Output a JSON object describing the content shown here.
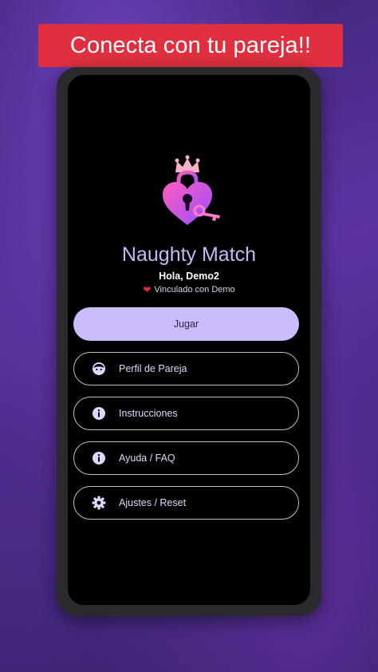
{
  "banner": {
    "text": "Conecta con tu pareja!!"
  },
  "app": {
    "title": "Naughty Match",
    "greeting": "Hola, Demo2",
    "linked_text": "Vinculado con Demo",
    "linked_icon": "heart-icon"
  },
  "buttons": {
    "play": "Jugar",
    "profile": {
      "label": "Perfil de Pareja",
      "icon": "face-icon"
    },
    "instructions": {
      "label": "Instrucciones",
      "icon": "info-icon"
    },
    "help": {
      "label": "Ayuda / FAQ",
      "icon": "info-icon"
    },
    "settings": {
      "label": "Ajustes / Reset",
      "icon": "gear-icon"
    }
  },
  "colors": {
    "banner": "#e0303f",
    "accent": "#cdbcfb",
    "title": "#c9b6f5",
    "logo_pink": "#ff4fb8",
    "logo_purple": "#9b4dff",
    "crown": "#f3b3c4"
  }
}
